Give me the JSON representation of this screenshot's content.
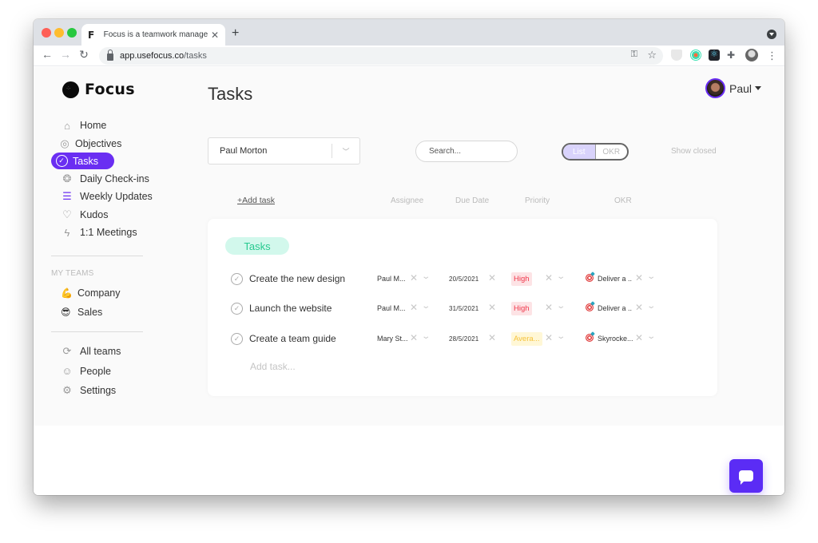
{
  "browser": {
    "tab_favicon": "F",
    "tab_title": "Focus is a teamwork management",
    "tab_close": "✕",
    "new_tab": "+",
    "url_host": "app.usefocus.co",
    "url_path": "/tasks",
    "nav_back": "←",
    "nav_forward": "→",
    "nav_reload": "↻",
    "key_icon": "⚿",
    "star_icon": "☆",
    "puzzle_icon": "✚",
    "menu_icon": "⋮"
  },
  "sidebar": {
    "brand": "Focus",
    "items": [
      {
        "label": "Home",
        "icon": "home-icon",
        "glyph": "⌂"
      },
      {
        "label": "Objectives",
        "icon": "target-icon",
        "glyph": "◎"
      },
      {
        "label": "Tasks",
        "icon": "check-circle-icon",
        "glyph": "✓",
        "active": true
      },
      {
        "label": "Daily Check-ins",
        "icon": "people-circle-icon",
        "glyph": "❂"
      },
      {
        "label": "Weekly Updates",
        "icon": "document-icon",
        "glyph": "☰"
      },
      {
        "label": "Kudos",
        "icon": "heart-icon",
        "glyph": "♡"
      },
      {
        "label": "1:1 Meetings",
        "icon": "lightning-icon",
        "glyph": "ϟ"
      }
    ],
    "teams_label": "MY TEAMS",
    "teams": [
      {
        "label": "Company",
        "emoji": "💪"
      },
      {
        "label": "Sales",
        "emoji": "😎"
      }
    ],
    "bottom_items": [
      {
        "label": "All teams",
        "icon": "teams-icon",
        "glyph": "⟳"
      },
      {
        "label": "People",
        "icon": "people-icon",
        "glyph": "☺"
      },
      {
        "label": "Settings",
        "icon": "gear-icon",
        "glyph": "⚙"
      }
    ]
  },
  "header": {
    "title": "Tasks",
    "user_name": "Paul"
  },
  "controls": {
    "person_select_value": "Paul Morton",
    "person_select_chevron": "﹀",
    "search_placeholder": "Search...",
    "view_toggle": [
      "List",
      "OKR"
    ],
    "view_selected": "List",
    "show_closed": "Show closed"
  },
  "columns": {
    "add_task": "+Add task",
    "assignee": "Assignee",
    "due_date": "Due Date",
    "priority": "Priority",
    "okr": "OKR"
  },
  "task_group": {
    "name": "Tasks",
    "tasks": [
      {
        "title": "Create the new design",
        "assignee": "Paul M...",
        "due": "20/5/2021",
        "priority": "High",
        "priority_level": "high",
        "okr": "Deliver a .."
      },
      {
        "title": "Launch the website",
        "assignee": "Paul M...",
        "due": "31/5/2021",
        "priority": "High",
        "priority_level": "high",
        "okr": "Deliver a .."
      },
      {
        "title": "Create a team guide",
        "assignee": "Mary St...",
        "due": "28/5/2021",
        "priority": "Avera...",
        "priority_level": "average",
        "okr": "Skyrocke..."
      }
    ],
    "add_task_placeholder": "Add task..."
  },
  "glyphs": {
    "check": "✓",
    "clear": "✕",
    "chevron": "⌄"
  },
  "colors": {
    "accent": "#6a2ef2",
    "chat_button": "#5b2cf5",
    "group_pill_bg": "#d2f8ec",
    "group_pill_text": "#27c98f",
    "priority_high_bg": "#fde3e5",
    "priority_high_text": "#f0384c",
    "priority_average_bg": "#fff7d6",
    "priority_average_text": "#f5c23a"
  }
}
